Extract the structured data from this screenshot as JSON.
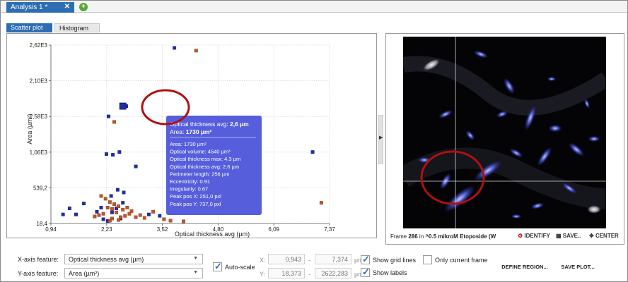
{
  "tabs": {
    "document_tab": "Analysis 1 *",
    "close_glyph": "✕",
    "add_glyph": "+"
  },
  "subtabs": [
    "Scatter plot",
    "Histogram"
  ],
  "plot": {
    "ylabel": "Area (µm²)",
    "xlabel": "Optical thickness avg (µm)",
    "x_ticks": [
      "0,94",
      "2,23",
      "3,52",
      "4,80",
      "6,09",
      "7,37"
    ],
    "y_ticks": [
      "2,62E3",
      "2,10E3",
      "1,58E3",
      "1,06E3",
      "539,2",
      "18,4"
    ],
    "colors": {
      "blue_series": "#1f2fa8",
      "orange_series": "#c0562a",
      "tooltip": "#4a52d9",
      "annotation": "#b01010"
    }
  },
  "chart_data": {
    "type": "scatter",
    "xlabel": "Optical thickness avg (µm)",
    "ylabel": "Area (µm²)",
    "xlim": [
      0.94,
      7.37
    ],
    "ylim": [
      18.4,
      2620
    ],
    "grid": true,
    "selected_point": {
      "x": 2.6,
      "y": 1730
    },
    "series": [
      {
        "color": "#1f2fa8",
        "points": [
          [
            2.68,
            1730
          ],
          [
            3.79,
            2580
          ],
          [
            2.27,
            1580
          ],
          [
            2.52,
            1060
          ],
          [
            2.37,
            1020
          ],
          [
            6.98,
            1060
          ],
          [
            2.22,
            1030
          ],
          [
            1.37,
            240
          ],
          [
            1.7,
            310
          ],
          [
            1.52,
            150
          ],
          [
            1.22,
            150
          ],
          [
            2.0,
            190
          ],
          [
            2.1,
            250
          ],
          [
            2.45,
            240
          ],
          [
            2.6,
            320
          ],
          [
            2.33,
            420
          ],
          [
            2.48,
            510
          ],
          [
            2.62,
            470
          ],
          [
            2.9,
            850
          ],
          [
            2.35,
            180
          ],
          [
            2.55,
            90
          ],
          [
            2.15,
            80
          ],
          [
            2.25,
            55
          ],
          [
            3.2,
            150
          ],
          [
            3.45,
            130
          ]
        ]
      },
      {
        "color": "#c0562a",
        "points": [
          [
            4.29,
            2540
          ],
          [
            2.4,
            1500
          ],
          [
            2.1,
            420
          ],
          [
            2.2,
            380
          ],
          [
            2.3,
            330
          ],
          [
            2.4,
            300
          ],
          [
            2.5,
            270
          ],
          [
            2.25,
            250
          ],
          [
            2.35,
            230
          ],
          [
            2.6,
            220
          ],
          [
            2.7,
            250
          ],
          [
            2.8,
            200
          ],
          [
            2.45,
            180
          ],
          [
            2.15,
            160
          ],
          [
            2.05,
            140
          ],
          [
            1.95,
            120
          ],
          [
            2.55,
            110
          ],
          [
            2.65,
            130
          ],
          [
            2.75,
            160
          ],
          [
            2.9,
            110
          ],
          [
            3.0,
            140
          ],
          [
            3.1,
            100
          ],
          [
            2.35,
            90
          ],
          [
            2.5,
            70
          ],
          [
            2.3,
            60
          ],
          [
            3.3,
            190
          ],
          [
            3.55,
            80
          ],
          [
            3.7,
            60
          ],
          [
            4.0,
            50
          ],
          [
            7.18,
            320
          ]
        ]
      }
    ]
  },
  "tooltip": {
    "title_prefix": "Optical thickness avg: ",
    "title_value": "2,6 µm",
    "area_prefix": "Area: ",
    "area_value": "1730 µm²",
    "lines": [
      "Area: 1730 µm²",
      "Optical volume: 4540 µm³",
      "Optical thickness max: 4.3 µm",
      "Optical thickness avg: 2.6 µm",
      "Perimeter length: 256 µm",
      "Eccentricity: 0.91",
      "Irregularity: 0.67",
      "Peak pos X: 251,0 pxl",
      "Peak pos Y: 737,0 pxl"
    ]
  },
  "image_view": {
    "frame_prefix": "Frame ",
    "frame_number": "286",
    "frame_in": " in ",
    "frame_name": "^0.5 mikroM Etoposide (W",
    "identify": "IDENTIFY",
    "save": "SAVE..",
    "center": "CENTER"
  },
  "controls": {
    "x_label": "X-axis feature:",
    "x_value": "Optical thickness avg (µm)",
    "y_label": "Y-axis feature:",
    "y_value": "Area (µm²)",
    "autoscale": "Auto-scale",
    "x_short": "X:",
    "y_short": "Y:",
    "x_min": "0,943",
    "x_max": "7,374",
    "x_unit": "µm",
    "y_min": "18,373",
    "y_max": "2622,283",
    "y_unit": "µm²",
    "dash": "-",
    "show_grid": "Show grid lines",
    "only_current": "Only current frame",
    "show_labels": "Show labels",
    "define_region": "DEFINE REGION...",
    "save_plot": "SAVE PLOT..."
  }
}
